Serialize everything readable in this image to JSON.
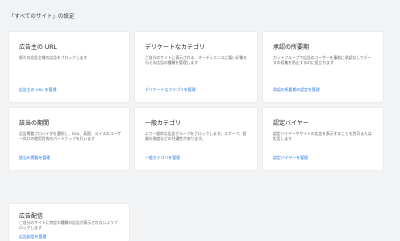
{
  "page": {
    "title": "「すべてのサイト」の設定"
  },
  "cards": [
    {
      "title": "広告主の URL",
      "description": "個々の広告主様の広告をブロックします",
      "link": "広告主の URL を管理"
    },
    {
      "title": "デリケートなカテゴリ",
      "description": "ご自分のサイトに表示される、オーディエンスに悪い印象を与える広告の種類を管理します",
      "link": "デリケートなカテゴリを管理"
    },
    {
      "title": "承認の所要期",
      "description": "カットフループで広告のユーザーを事前に承認なしでデータの収集を防止するのに役立ちます",
      "link": "承認の所要期の設定を管理"
    },
    {
      "title": "該当の期間",
      "description": "広告掲載プロバイダを選択し、EEA、英国、スイスのユーザー向けの使用目的のパートナップを行います",
      "link": "該当の掲載を管理"
    },
    {
      "title": "一般カテゴリ",
      "description": "より一般的な広告グループをブロックします。スポーツ、投資の過度などの共通性があります。",
      "link": "一般カテゴリを管理"
    },
    {
      "title": "認定バイヤー",
      "description": "認定バイヤーやサイトの広告を表示することを許可または拒否します",
      "link": "認定バイヤーを管理"
    },
    {
      "title": "広告配信",
      "description": "ご自分のサイトに特定の種類の広告が表示されないようブロックします",
      "link": "広告配信を管理"
    }
  ]
}
